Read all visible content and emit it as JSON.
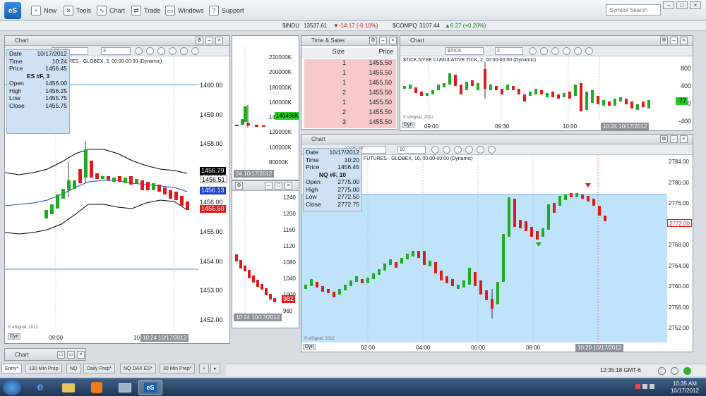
{
  "toolbar": {
    "logo": "eS",
    "new": "New",
    "tools": "Tools",
    "chart": "Chart",
    "trade": "Trade",
    "windows": "Windows",
    "support": "Support",
    "search_placeholder": "Symbol Search"
  },
  "ticker": {
    "s1": "$INDU",
    "s1_price": "13537.61",
    "s1_chg": "▼-14.17 (-0.10%)",
    "s2": "$COMPQ",
    "s2_price": "3107.44",
    "s2_chg": "▲6.27 (+0.20%)"
  },
  "es_chart": {
    "title": "Chart",
    "symbol": "ES #F",
    "interval": "3",
    "caption": "RES - GLOBEX, 3, 00:00-00:00 (Dynamic)",
    "info": {
      "date_l": "Date",
      "date": "10/17/2012",
      "time_l": "Time",
      "time": "10:24",
      "price_l": "Price",
      "price": "1456.45",
      "head": "ES #F, 3",
      "open_l": "Open",
      "open": "1456.00",
      "high_l": "High",
      "high": "1456.25",
      "low_l": "Low",
      "low": "1455.75",
      "close_l": "Close",
      "close": "1455.75"
    },
    "yticks": [
      "1460.00",
      "1459.00",
      "1458.00",
      "1457.00",
      "1456.00",
      "1455.00",
      "1454.00",
      "1453.00",
      "1452.00"
    ],
    "tags": {
      "t1": "1456.79",
      "t2": "1456.51",
      "t3": "1456.13",
      "t4": "1455.50"
    },
    "xlabel": "09:00",
    "xlabel2": "10",
    "datebox": "10:24 10/17/2012",
    "dyn": "Dyn",
    "credit": "© eSignal, 2012"
  },
  "vol_chart": {
    "yticks": [
      "220000K",
      "200000K",
      "180000K",
      "160000K",
      "140000K",
      "120000K",
      "100000K",
      "80000K"
    ],
    "tag": "140498K",
    "datebox": "24 10/17/2012"
  },
  "mid_chart": {
    "yticks": [
      "1240",
      "1200",
      "1160",
      "1120",
      "1080",
      "1040",
      "1000",
      "960"
    ],
    "tag": "982",
    "datebox": "10:24 10/17/2012"
  },
  "ts": {
    "title": "Time & Sales",
    "col_size": "Size",
    "col_price": "Price",
    "rows": [
      {
        "size": "1",
        "price": "1455.50"
      },
      {
        "size": "1",
        "price": "1455.50"
      },
      {
        "size": "1",
        "price": "1455.50"
      },
      {
        "size": "2",
        "price": "1455.50"
      },
      {
        "size": "1",
        "price": "1455.50"
      },
      {
        "size": "2",
        "price": "1455.50"
      },
      {
        "size": "3",
        "price": "1455.50"
      }
    ]
  },
  "tick_chart": {
    "title": "Chart",
    "symbol": "$TICK",
    "interval": "2",
    "caption": "$TICK,NYSE CUMULATIVE TICK, 2, 00:00-00:00 (Dynamic)",
    "yticks": [
      "800",
      "400",
      "0",
      "-400"
    ],
    "tag": "-77",
    "x": [
      "09:00",
      "09:30",
      "10:00"
    ],
    "datebox": "10:24 10/17/2012",
    "dyn": "Dyn",
    "credit": "© eSignal, 2012"
  },
  "nq_chart": {
    "title": "Chart",
    "symbol": "NQ #F",
    "interval": "10",
    "caption": "I FUTURES - GLOBEX, 10, 00:00-00:00 (Dynamic)",
    "info": {
      "date_l": "Date",
      "date": "10/17/2012",
      "time_l": "Time",
      "time": "10:20",
      "price_l": "Price",
      "price": "1456.45",
      "head": "NQ #F, 10",
      "open_l": "Open",
      "open": "2775.00",
      "high_l": "High",
      "high": "2775.00",
      "low_l": "Low",
      "low": "2772.50",
      "close_l": "Close",
      "close": "2772.75"
    },
    "yticks": [
      "2784.00",
      "2780.00",
      "2776.00",
      "2772.00",
      "2768.00",
      "2764.00",
      "2760.00",
      "2756.00",
      "2752.00"
    ],
    "tag": "2772.00",
    "x": [
      "02:00",
      "04:00",
      "06:00",
      "08:00"
    ],
    "datebox": "10:20 10/17/2012",
    "dyn": "Dyn",
    "credit": "© eSignal, 2012"
  },
  "minichart": {
    "title": "Chart"
  },
  "tabs": [
    "Entry*",
    "130 Min Prep",
    "NQ",
    "Daily Prep*",
    "NQ DAX ES*",
    "30 Min Prep*"
  ],
  "tab_add": "+",
  "status": {
    "clock": "12:35:18 GMT-6"
  },
  "taskbar": {
    "time": "10:35 AM",
    "date": "10/17/2012",
    "es_label": "eS"
  },
  "colors": {
    "up": "#22aa22",
    "down": "#dd1b1b",
    "band": "#bfe3fb",
    "accent": "#1c5fb0"
  }
}
